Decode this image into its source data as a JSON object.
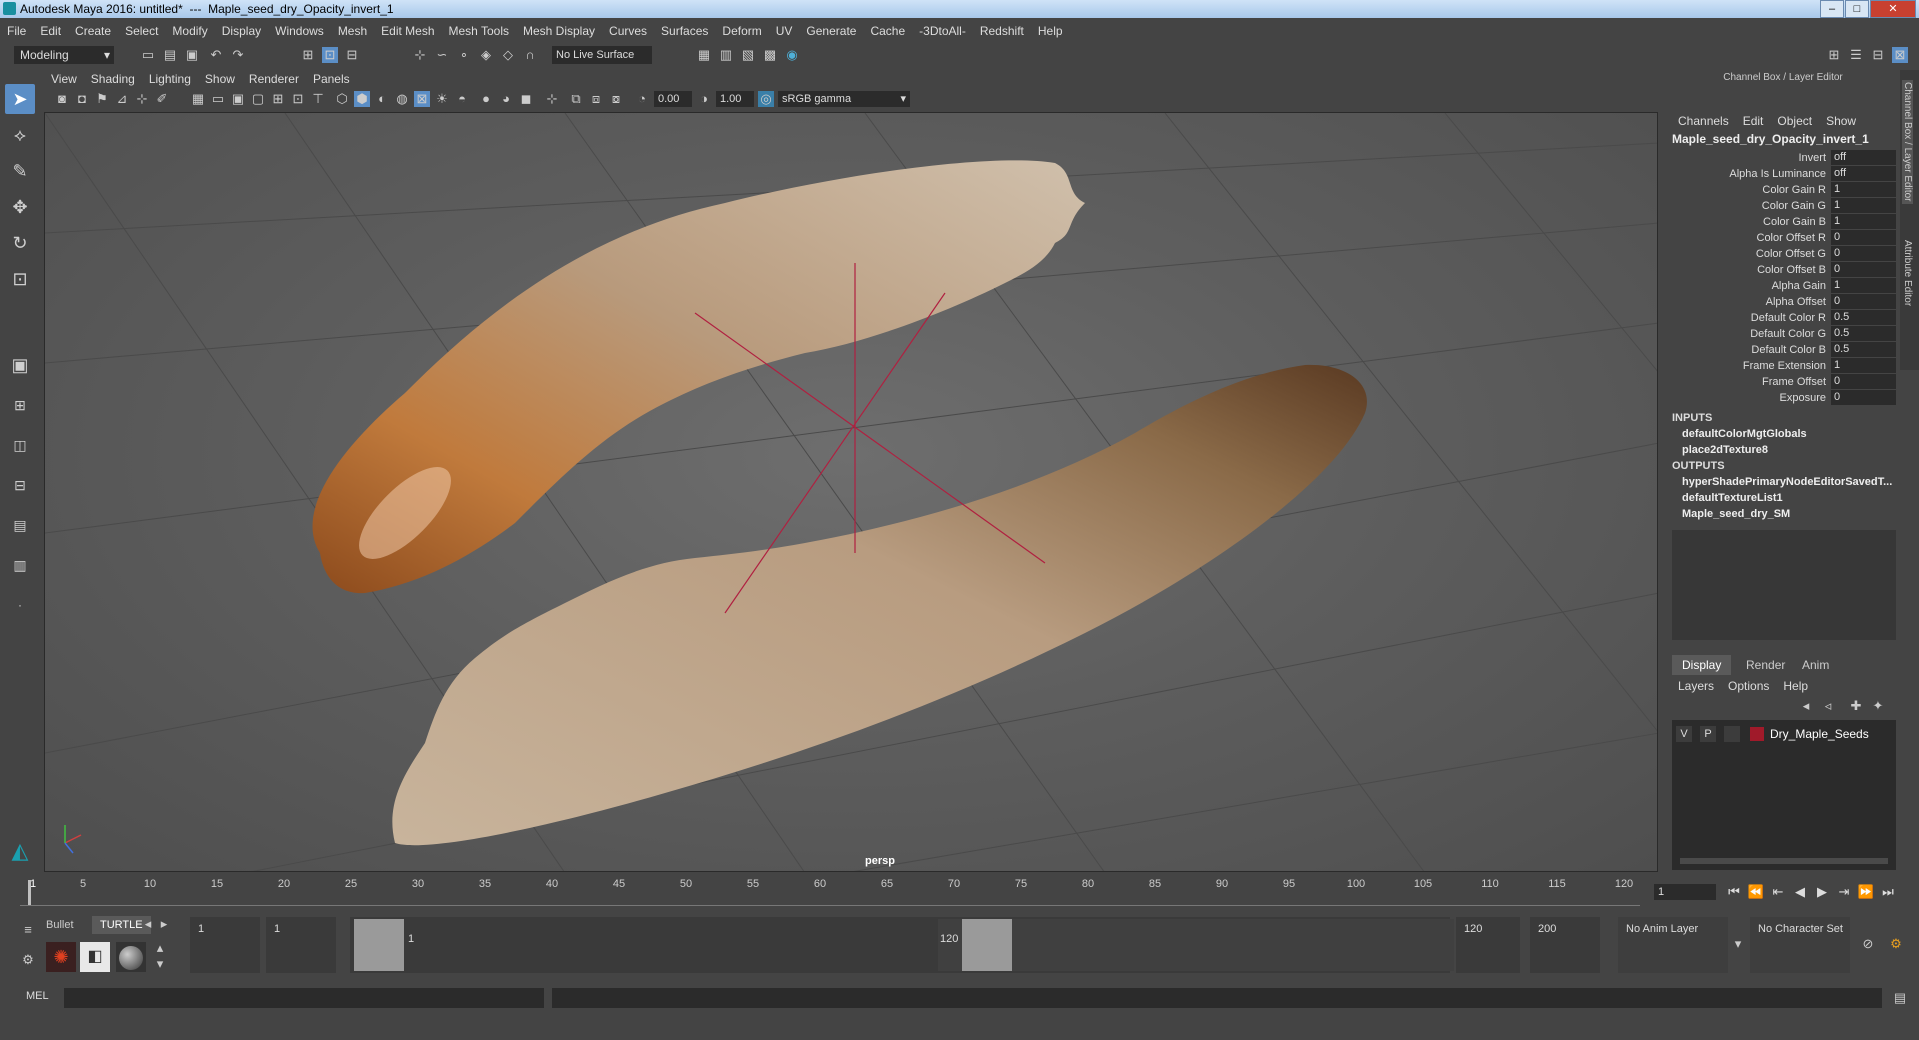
{
  "window": {
    "title_app": "Autodesk Maya 2016: untitled*",
    "title_sep": "---",
    "title_node": "Maple_seed_dry_Opacity_invert_1",
    "minimize": "–",
    "maximize": "□",
    "close": "✕"
  },
  "menubar": [
    "File",
    "Edit",
    "Create",
    "Select",
    "Modify",
    "Display",
    "Windows",
    "Mesh",
    "Edit Mesh",
    "Mesh Tools",
    "Mesh Display",
    "Curves",
    "Surfaces",
    "Deform",
    "UV",
    "Generate",
    "Cache",
    "-3DtoAll-",
    "Redshift",
    "Help"
  ],
  "statusline": {
    "mode": "Modeling",
    "live_surface": "No Live Surface"
  },
  "panel": {
    "menu": [
      "View",
      "Shading",
      "Lighting",
      "Show",
      "Renderer",
      "Panels"
    ],
    "exposure": "0.00",
    "gamma": "1.00",
    "colorspace": "sRGB gamma",
    "camera_label": "persp"
  },
  "channelbox": {
    "title": "Channel Box / Layer Editor",
    "menu": [
      "Channels",
      "Edit",
      "Object",
      "Show"
    ],
    "node": "Maple_seed_dry_Opacity_invert_1",
    "attrs": [
      {
        "name": "Invert",
        "value": "off"
      },
      {
        "name": "Alpha Is Luminance",
        "value": "off"
      },
      {
        "name": "Color Gain R",
        "value": "1"
      },
      {
        "name": "Color Gain G",
        "value": "1"
      },
      {
        "name": "Color Gain B",
        "value": "1"
      },
      {
        "name": "Color Offset R",
        "value": "0"
      },
      {
        "name": "Color Offset G",
        "value": "0"
      },
      {
        "name": "Color Offset B",
        "value": "0"
      },
      {
        "name": "Alpha Gain",
        "value": "1"
      },
      {
        "name": "Alpha Offset",
        "value": "0"
      },
      {
        "name": "Default Color R",
        "value": "0.5"
      },
      {
        "name": "Default Color G",
        "value": "0.5"
      },
      {
        "name": "Default Color B",
        "value": "0.5"
      },
      {
        "name": "Frame Extension",
        "value": "1"
      },
      {
        "name": "Frame Offset",
        "value": "0"
      },
      {
        "name": "Exposure",
        "value": "0"
      }
    ],
    "inputs_label": "INPUTS",
    "inputs": [
      "defaultColorMgtGlobals",
      "place2dTexture8"
    ],
    "outputs_label": "OUTPUTS",
    "outputs": [
      "hyperShadePrimaryNodeEditorSavedT...",
      "defaultTextureList1",
      "Maple_seed_dry_SM"
    ]
  },
  "layers": {
    "tabs": [
      "Display",
      "Render",
      "Anim"
    ],
    "menu": [
      "Layers",
      "Options",
      "Help"
    ],
    "row": {
      "v": "V",
      "p": "P",
      "name": "Dry_Maple_Seeds",
      "color": "#a01a2a"
    }
  },
  "sidetabs": [
    "Channel Box / Layer Editor",
    "Attribute Editor"
  ],
  "timeline": {
    "ticks": [
      "5",
      "10",
      "15",
      "20",
      "25",
      "30",
      "35",
      "40",
      "45",
      "50",
      "55",
      "60",
      "65",
      "70",
      "75",
      "80",
      "85",
      "90",
      "95",
      "100",
      "105",
      "110",
      "115",
      "120"
    ],
    "start_marker": "1",
    "current_frame": "1"
  },
  "range": {
    "shelf_tabs": [
      "Bullet",
      "TURTLE"
    ],
    "start": "1",
    "playback_start": "1",
    "slider_start": "1",
    "slider_end": "120",
    "playback_end": "120",
    "end": "200",
    "anim_layer": "No Anim Layer",
    "char_set": "No Character Set"
  },
  "cmd": {
    "label": "MEL"
  }
}
